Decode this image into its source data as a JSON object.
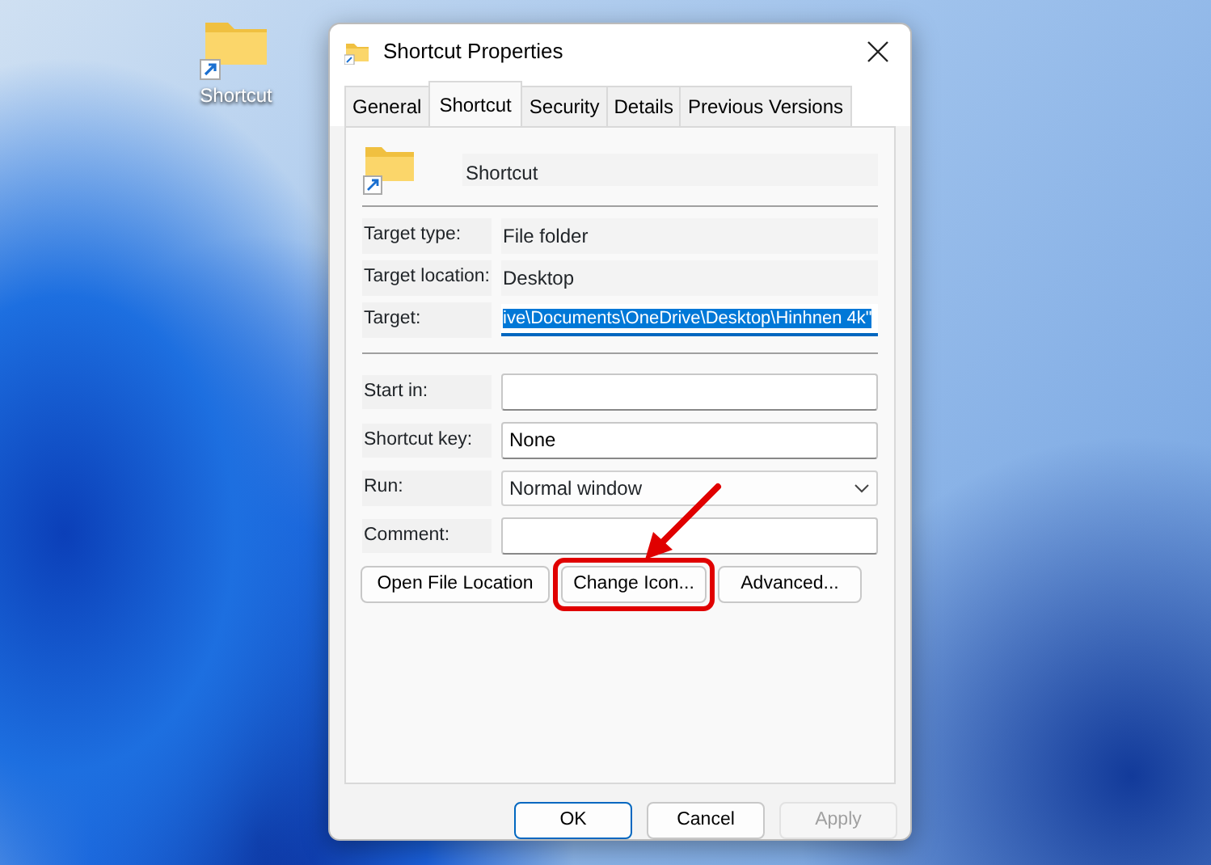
{
  "desktop_icon": {
    "label": "Shortcut"
  },
  "window": {
    "title": "Shortcut Properties"
  },
  "tabs": [
    {
      "label": "General",
      "selected": false
    },
    {
      "label": "Shortcut",
      "selected": true
    },
    {
      "label": "Security",
      "selected": false
    },
    {
      "label": "Details",
      "selected": false
    },
    {
      "label": "Previous Versions",
      "selected": false
    }
  ],
  "header": {
    "name": "Shortcut"
  },
  "info_rows": [
    {
      "label": "Target type:",
      "value": "File folder",
      "kind": "text"
    },
    {
      "label": "Target location:",
      "value": "Desktop",
      "kind": "text"
    },
    {
      "label": "Target:",
      "value": "ive\\Documents\\OneDrive\\Desktop\\Hinhnen 4k\"",
      "kind": "field",
      "selected": true
    }
  ],
  "fields": [
    {
      "label": "Start in:",
      "kind": "input"
    },
    {
      "label": "Shortcut key:",
      "value": "None",
      "kind": "input"
    },
    {
      "label": "Run:",
      "value": "Normal window",
      "kind": "dropdown"
    },
    {
      "label": "Comment:",
      "kind": "input"
    }
  ],
  "action_buttons": [
    {
      "label": "Open File Location",
      "highlighted": false
    },
    {
      "label": "Change Icon...",
      "highlighted": true
    },
    {
      "label": "Advanced...",
      "highlighted": false
    }
  ],
  "dialog_buttons": [
    {
      "label": "OK",
      "default": true,
      "disabled": false
    },
    {
      "label": "Cancel",
      "default": false,
      "disabled": false
    },
    {
      "label": "Apply",
      "default": false,
      "disabled": true
    }
  ]
}
